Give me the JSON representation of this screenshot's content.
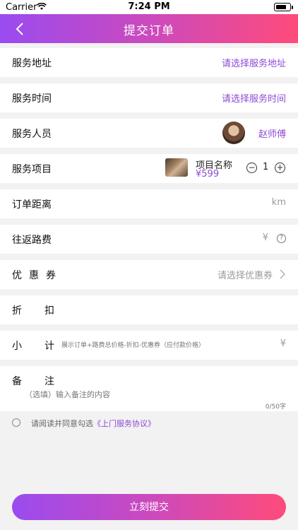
{
  "status_bar": {
    "carrier": "Carrier",
    "time": "7:24 PM"
  },
  "navbar": {
    "title": "提交订单",
    "back_icon": "chevron-left-icon"
  },
  "rows": {
    "address": {
      "label": "服务地址",
      "value": "请选择服务地址"
    },
    "time": {
      "label": "服务时间",
      "value": "请选择服务时间"
    },
    "staff": {
      "label": "服务人员",
      "name": "赵师傅"
    },
    "item": {
      "label": "服务项目",
      "name": "项目名称",
      "price": "¥599",
      "quantity": "1",
      "minus": "−",
      "plus": "+"
    },
    "distance": {
      "label": "订单距离",
      "unit": "km"
    },
    "fare": {
      "label": "往返路费",
      "currency": "¥",
      "help": "?"
    },
    "coupon": {
      "label": "优惠券",
      "value": "请选择优惠券"
    },
    "discount": {
      "label": "折扣"
    },
    "subtotal": {
      "label": "小计",
      "note": "展示订单+路费总价格-折扣-优惠券（应付款价格）",
      "currency": "¥"
    }
  },
  "remark": {
    "label": "备注",
    "placeholder": "（选填）输入备注的内容",
    "count": "0/50字"
  },
  "agreement": {
    "prefix": "请阅读并同意勾选",
    "link": "《上门服务协议》"
  },
  "submit_label": "立刻提交",
  "colors": {
    "accent": "#8e4ad6",
    "gradient_start": "#9a4bf0",
    "gradient_end": "#ff4b7a"
  }
}
